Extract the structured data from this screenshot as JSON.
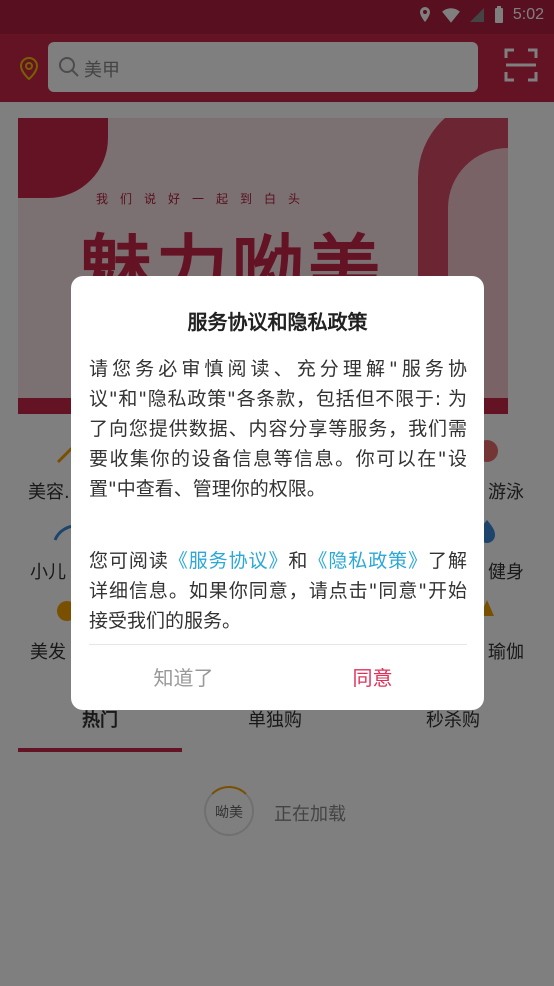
{
  "status_bar": {
    "time": "5:02"
  },
  "header": {
    "search_placeholder": "美甲"
  },
  "banner": {
    "tagline": "我们说好一起到白头",
    "title": "魅力呦美"
  },
  "categories": [
    {
      "label": "美容..."
    },
    {
      "label": "游泳"
    },
    {
      "label": "小儿"
    },
    {
      "label": "健身"
    },
    {
      "label": "美发"
    },
    {
      "label": "瑜伽"
    }
  ],
  "tabs": [
    {
      "label": "热门"
    },
    {
      "label": "单独购"
    },
    {
      "label": "秒杀购"
    }
  ],
  "loading": {
    "logo_text": "呦美",
    "label": "正在加载"
  },
  "dialog": {
    "title": "服务协议和隐私政策",
    "body": "请您务必审慎阅读、充分理解\"服务协议\"和\"隐私政策\"各条款，包括但不限于: 为了向您提供数据、内容分享等服务，我们需要收集你的设备信息等信息。你可以在\"设置\"中查看、管理你的权限。",
    "body2_prefix": "您可阅读",
    "link_service": "《服务协议》",
    "body2_and": "和",
    "link_privacy": "《隐私政策》",
    "body2_suffix": "了解详细信息。如果你同意，请点击\"同意\"开始接受我们的服务。",
    "btn_later": "知道了",
    "btn_agree": "同意"
  },
  "colors": {
    "brand": "#c8264a",
    "link": "#2aa8d8",
    "agree": "#e0305a"
  }
}
